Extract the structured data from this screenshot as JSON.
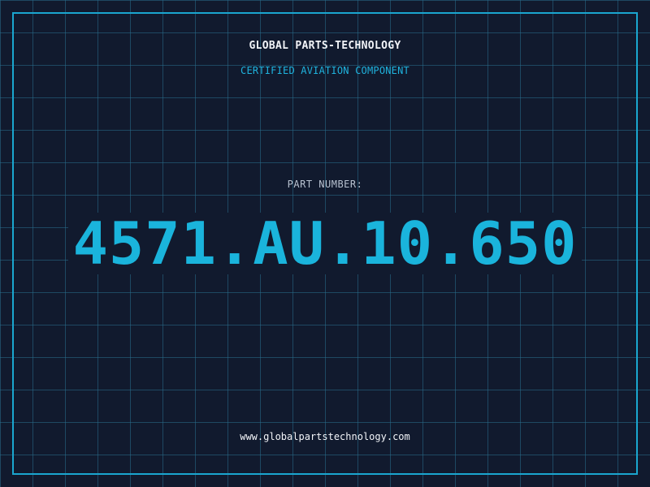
{
  "header": {
    "company": "GLOBAL PARTS-TECHNOLOGY",
    "subtitle": "CERTIFIED AVIATION COMPONENT"
  },
  "part": {
    "label": "PART NUMBER:",
    "number": "4571.AU.10.650"
  },
  "footer": {
    "website": "www.globalpartstechnology.com"
  },
  "colors": {
    "background": "#111a2e",
    "grid": "#286e8c",
    "frame": "#1aa6cf",
    "accent": "#1ab4dc",
    "text": "#f2f4f8",
    "muted": "#b8c2d0"
  }
}
